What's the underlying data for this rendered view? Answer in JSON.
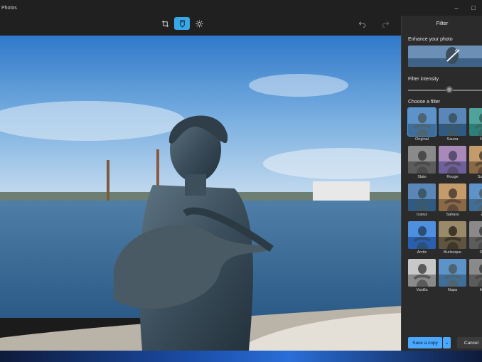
{
  "window": {
    "title": "Photos",
    "controls": [
      "minimize-icon",
      "maximize-icon"
    ]
  },
  "toolbar": {
    "tools": [
      {
        "name": "crop-icon",
        "active": false
      },
      {
        "name": "filter-icon",
        "active": true
      },
      {
        "name": "adjust-brightness-icon",
        "active": false
      }
    ],
    "undo_icon": "undo-icon",
    "redo_icon": "redo-icon"
  },
  "panel": {
    "title": "Filter",
    "enhance_label": "Enhance your photo",
    "intensity_label": "Filter intensity",
    "intensity_value": 0.55,
    "choose_label": "Choose a filter",
    "filters": [
      {
        "label": "Original",
        "tone": "color",
        "selected": true
      },
      {
        "label": "Sauna",
        "tone": "cool",
        "selected": false
      },
      {
        "label": "Nor",
        "tone": "teal",
        "selected": false
      },
      {
        "label": "Slate",
        "tone": "gray",
        "selected": false
      },
      {
        "label": "Rouge",
        "tone": "rose",
        "selected": false
      },
      {
        "label": "Sunse",
        "tone": "warm",
        "selected": false
      },
      {
        "label": "Icarus",
        "tone": "cool",
        "selected": false
      },
      {
        "label": "Sahara",
        "tone": "warm",
        "selected": false
      },
      {
        "label": "Ze",
        "tone": "color",
        "selected": false
      },
      {
        "label": "Arctic",
        "tone": "blue",
        "selected": false
      },
      {
        "label": "Burlesque",
        "tone": "sepia",
        "selected": false
      },
      {
        "label": "Dea",
        "tone": "gray",
        "selected": false
      },
      {
        "label": "Vanilla",
        "tone": "mono",
        "selected": false
      },
      {
        "label": "Napa",
        "tone": "color",
        "selected": false
      },
      {
        "label": "Mer",
        "tone": "gray",
        "selected": false
      }
    ],
    "save_label": "Save a copy",
    "cancel_label": "Cancel"
  },
  "colors": {
    "accent": "#4aa8ff",
    "active_tool": "#39a6e6",
    "panel_bg": "#2b2b2b",
    "toolbar_bg": "#202020"
  }
}
